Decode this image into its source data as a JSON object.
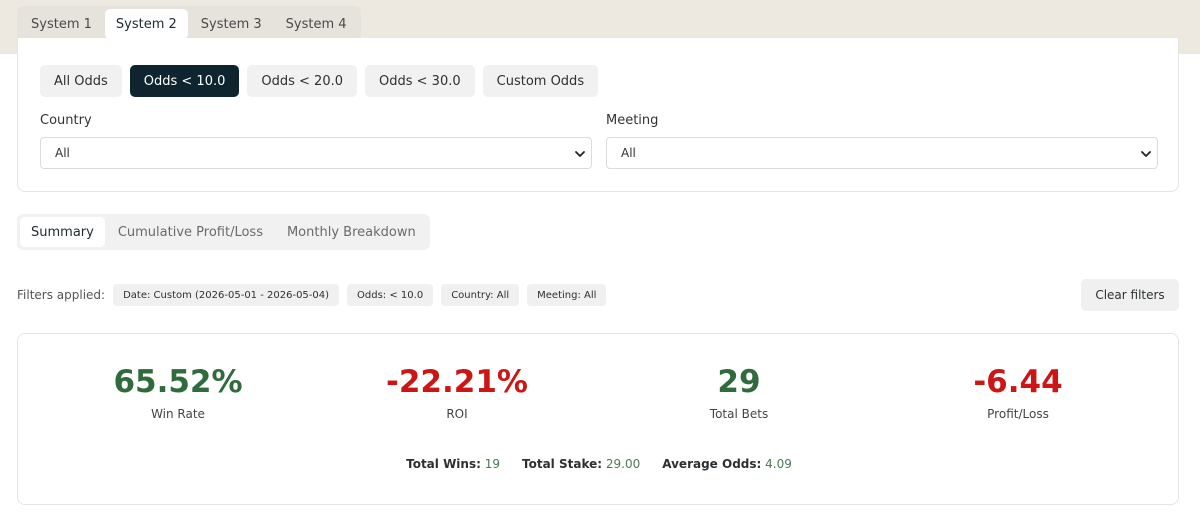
{
  "system_tabs": [
    {
      "label": "System 1",
      "active": false
    },
    {
      "label": "System 2",
      "active": true
    },
    {
      "label": "System 3",
      "active": false
    },
    {
      "label": "System 4",
      "active": false
    }
  ],
  "odds_filters": [
    {
      "label": "All Odds",
      "active": false
    },
    {
      "label": "Odds < 10.0",
      "active": true
    },
    {
      "label": "Odds < 20.0",
      "active": false
    },
    {
      "label": "Odds < 30.0",
      "active": false
    },
    {
      "label": "Custom Odds",
      "active": false
    }
  ],
  "country": {
    "label": "Country",
    "value": "All"
  },
  "meeting": {
    "label": "Meeting",
    "value": "All"
  },
  "view_tabs": [
    {
      "label": "Summary",
      "active": true
    },
    {
      "label": "Cumulative Profit/Loss",
      "active": false
    },
    {
      "label": "Monthly Breakdown",
      "active": false
    }
  ],
  "filters_applied": {
    "label": "Filters applied:",
    "chips": [
      "Date: Custom (2026-05-01 - 2026-05-04)",
      "Odds: < 10.0",
      "Country: All",
      "Meeting: All"
    ],
    "clear_label": "Clear filters"
  },
  "summary": {
    "stats": [
      {
        "value": "65.52%",
        "label": "Win Rate",
        "color": "#2f6b3c"
      },
      {
        "value": "-22.21%",
        "label": "ROI",
        "color": "#cc1616"
      },
      {
        "value": "29",
        "label": "Total Bets",
        "color": "#2f6b3c"
      },
      {
        "value": "-6.44",
        "label": "Profit/Loss",
        "color": "#cc1616"
      }
    ],
    "totals": [
      {
        "key": "Total Wins:",
        "value": "19"
      },
      {
        "key": "Total Stake:",
        "value": "29.00"
      },
      {
        "key": "Average Odds:",
        "value": "4.09"
      }
    ]
  },
  "colors": {
    "accent_dark": "#0e2530",
    "positive": "#2f6b3c",
    "negative": "#cc1616",
    "top_band": "#ede8e0"
  },
  "icons": {
    "select_arrow": "chevron-down-icon"
  }
}
